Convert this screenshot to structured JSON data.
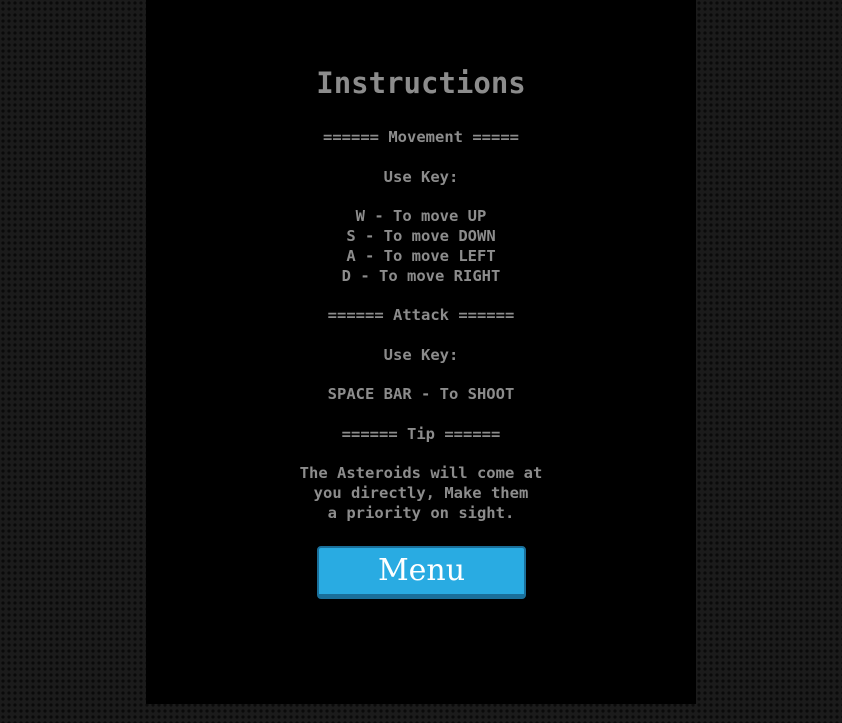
{
  "instructions": {
    "title": "Instructions",
    "movement_header": "====== Movement =====",
    "movement_use_key": "Use Key:",
    "movement_keys": [
      "W - To move UP",
      "S - To move DOWN",
      "A - To move LEFT",
      "D - To move RIGHT"
    ],
    "attack_header": "====== Attack ======",
    "attack_use_key": "Use Key:",
    "attack_key": "SPACE BAR - To SHOOT",
    "tip_header": "====== Tip ======",
    "tip_lines": [
      "The Asteroids will come at",
      "you directly, Make them",
      "a priority on sight."
    ],
    "menu_button": "Menu"
  },
  "colors": {
    "background": "#1b1b1b",
    "panel": "#000000",
    "text": "#8c8c8c",
    "button": "#29abe2",
    "button_border": "#1a6f9a",
    "button_text": "#ffffff"
  }
}
